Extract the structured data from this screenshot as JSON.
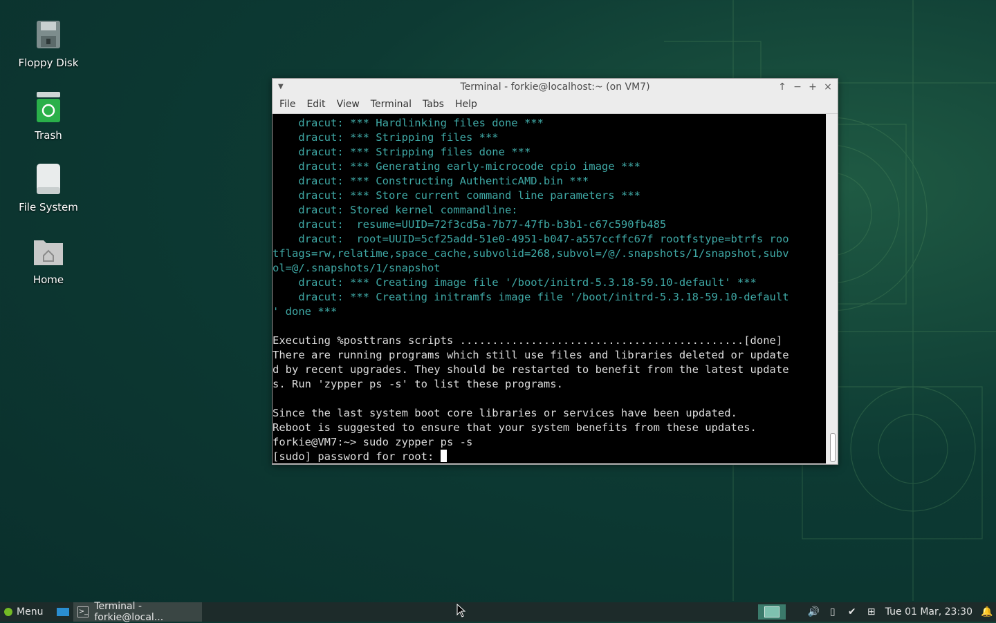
{
  "desktop": {
    "icons": [
      {
        "label": "Floppy Disk",
        "icon": "floppy-disk-icon"
      },
      {
        "label": "Trash",
        "icon": "trash-icon"
      },
      {
        "label": "File System",
        "icon": "drive-icon"
      },
      {
        "label": "Home",
        "icon": "home-folder-icon"
      }
    ]
  },
  "window": {
    "title": "Terminal - forkie@localhost:~ (on VM7)",
    "menu": [
      "File",
      "Edit",
      "View",
      "Terminal",
      "Tabs",
      "Help"
    ],
    "controls": [
      "↑",
      "−",
      "+",
      "×"
    ]
  },
  "terminal": {
    "lines": [
      {
        "text": "    dracut: *** Hardlinking files done ***",
        "style": "cyan"
      },
      {
        "text": "    dracut: *** Stripping files ***",
        "style": "cyan"
      },
      {
        "text": "    dracut: *** Stripping files done ***",
        "style": "cyan"
      },
      {
        "text": "    dracut: *** Generating early-microcode cpio image ***",
        "style": "cyan"
      },
      {
        "text": "    dracut: *** Constructing AuthenticAMD.bin ***",
        "style": "cyan"
      },
      {
        "text": "    dracut: *** Store current command line parameters ***",
        "style": "cyan"
      },
      {
        "text": "    dracut: Stored kernel commandline:",
        "style": "cyan"
      },
      {
        "text": "    dracut:  resume=UUID=72f3cd5a-7b77-47fb-b3b1-c67c590fb485",
        "style": "cyan"
      },
      {
        "text": "    dracut:  root=UUID=5cf25add-51e0-4951-b047-a557ccffc67f rootfstype=btrfs roo",
        "style": "cyan"
      },
      {
        "text": "tflags=rw,relatime,space_cache,subvolid=268,subvol=/@/.snapshots/1/snapshot,subv",
        "style": "cyan"
      },
      {
        "text": "ol=@/.snapshots/1/snapshot",
        "style": "cyan"
      },
      {
        "text": "    dracut: *** Creating image file '/boot/initrd-5.3.18-59.10-default' ***",
        "style": "cyan"
      },
      {
        "text": "    dracut: *** Creating initramfs image file '/boot/initrd-5.3.18-59.10-default",
        "style": "cyan"
      },
      {
        "text": "' done ***",
        "style": "cyan"
      },
      {
        "text": "",
        "style": "plain"
      },
      {
        "text": "Executing %posttrans scripts ............................................[done]",
        "style": "plain"
      },
      {
        "text": "There are running programs which still use files and libraries deleted or update",
        "style": "plain"
      },
      {
        "text": "d by recent upgrades. They should be restarted to benefit from the latest update",
        "style": "plain"
      },
      {
        "text": "s. Run 'zypper ps -s' to list these programs.",
        "style": "plain"
      },
      {
        "text": "",
        "style": "plain"
      },
      {
        "text": "Since the last system boot core libraries or services have been updated.",
        "style": "plain"
      },
      {
        "text": "Reboot is suggested to ensure that your system benefits from these updates.",
        "style": "plain"
      },
      {
        "text": "forkie@VM7:~> sudo zypper ps -s",
        "style": "plain"
      }
    ],
    "prompt": "[sudo] password for root: "
  },
  "taskbar": {
    "menu_label": "Menu",
    "task_label": "Terminal - forkie@local...",
    "clock": "Tue 01 Mar, 23:30",
    "tray_icons": [
      "volume-icon",
      "battery-icon",
      "updates-check-icon",
      "network-icon",
      "bell-icon"
    ]
  }
}
